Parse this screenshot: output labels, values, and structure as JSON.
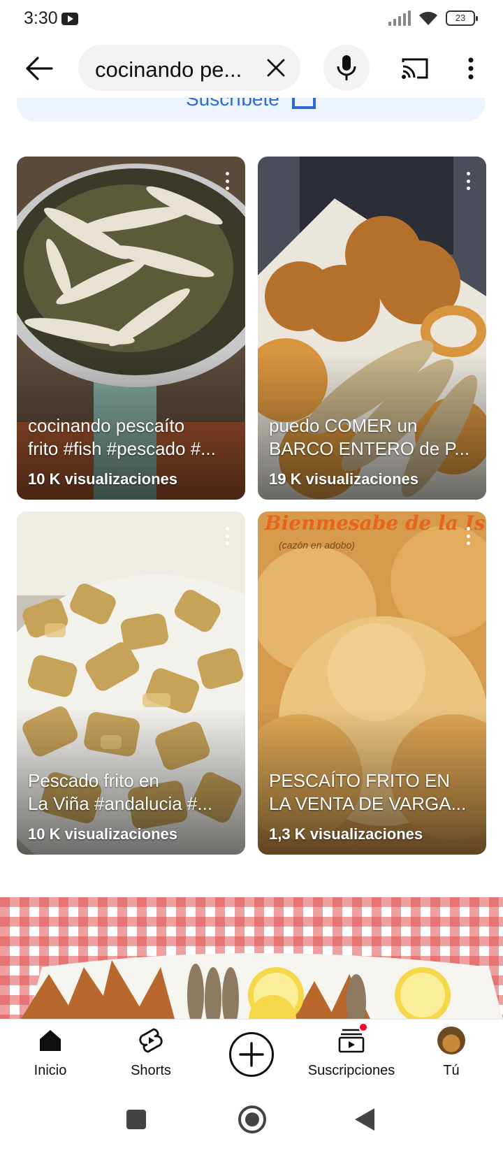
{
  "status_bar": {
    "time": "3:30",
    "battery": "23"
  },
  "search": {
    "query": "cocinando pe..."
  },
  "subscribe_card": {
    "label": "Suscríbete"
  },
  "shorts": [
    {
      "title_line1": "cocinando pescaíto",
      "title_line2": "frito #fish #pescado #...",
      "views": "10 K visualizaciones"
    },
    {
      "title_line1": "puedo COMER un",
      "title_line2": "BARCO ENTERO de P...",
      "views": "19 K visualizaciones"
    },
    {
      "title_line1": "Pescado frito en",
      "title_line2": "La Viña #andalucia #...",
      "views": "10 K visualizaciones"
    },
    {
      "title_line1": "PESCAÍTO FRITO EN",
      "title_line2": "LA VENTA DE VARGA...",
      "views": "1,3 K visualizaciones",
      "overlay_text": "Bienmesabe de la Isla",
      "overlay_subtext": "(cazón en adobo)"
    }
  ],
  "bottom_nav": {
    "items": [
      {
        "label": "Inicio",
        "icon": "home-icon"
      },
      {
        "label": "Shorts",
        "icon": "shorts-icon"
      },
      {
        "label": "",
        "icon": "create-icon"
      },
      {
        "label": "Suscripciones",
        "icon": "subscriptions-icon"
      },
      {
        "label": "Tú",
        "icon": "avatar"
      }
    ]
  },
  "colors": {
    "accent_blue": "#2e6ad6",
    "notification_red": "#ff0033"
  }
}
